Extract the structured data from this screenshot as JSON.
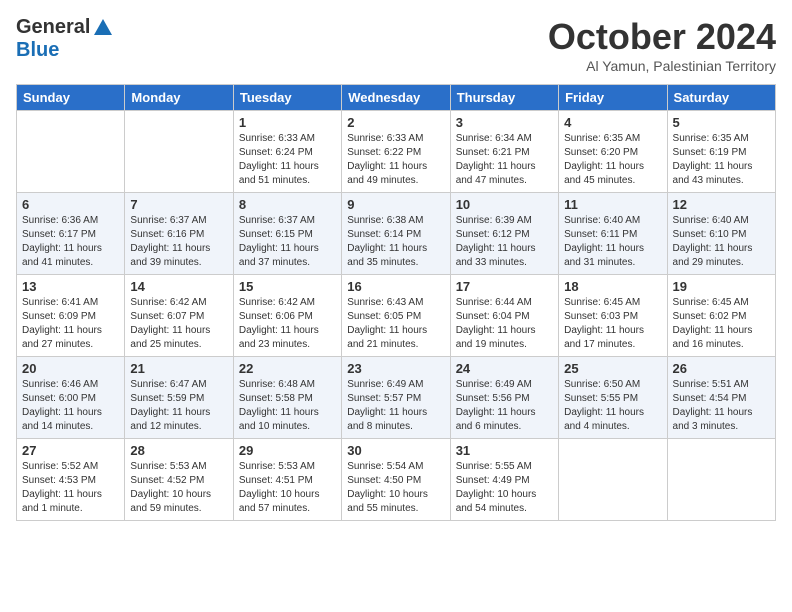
{
  "logo": {
    "general": "General",
    "blue": "Blue"
  },
  "title": "October 2024",
  "subtitle": "Al Yamun, Palestinian Territory",
  "days_of_week": [
    "Sunday",
    "Monday",
    "Tuesday",
    "Wednesday",
    "Thursday",
    "Friday",
    "Saturday"
  ],
  "weeks": [
    [
      {
        "day": "",
        "sunrise": "",
        "sunset": "",
        "daylight": ""
      },
      {
        "day": "",
        "sunrise": "",
        "sunset": "",
        "daylight": ""
      },
      {
        "day": "1",
        "sunrise": "Sunrise: 6:33 AM",
        "sunset": "Sunset: 6:24 PM",
        "daylight": "Daylight: 11 hours and 51 minutes."
      },
      {
        "day": "2",
        "sunrise": "Sunrise: 6:33 AM",
        "sunset": "Sunset: 6:22 PM",
        "daylight": "Daylight: 11 hours and 49 minutes."
      },
      {
        "day": "3",
        "sunrise": "Sunrise: 6:34 AM",
        "sunset": "Sunset: 6:21 PM",
        "daylight": "Daylight: 11 hours and 47 minutes."
      },
      {
        "day": "4",
        "sunrise": "Sunrise: 6:35 AM",
        "sunset": "Sunset: 6:20 PM",
        "daylight": "Daylight: 11 hours and 45 minutes."
      },
      {
        "day": "5",
        "sunrise": "Sunrise: 6:35 AM",
        "sunset": "Sunset: 6:19 PM",
        "daylight": "Daylight: 11 hours and 43 minutes."
      }
    ],
    [
      {
        "day": "6",
        "sunrise": "Sunrise: 6:36 AM",
        "sunset": "Sunset: 6:17 PM",
        "daylight": "Daylight: 11 hours and 41 minutes."
      },
      {
        "day": "7",
        "sunrise": "Sunrise: 6:37 AM",
        "sunset": "Sunset: 6:16 PM",
        "daylight": "Daylight: 11 hours and 39 minutes."
      },
      {
        "day": "8",
        "sunrise": "Sunrise: 6:37 AM",
        "sunset": "Sunset: 6:15 PM",
        "daylight": "Daylight: 11 hours and 37 minutes."
      },
      {
        "day": "9",
        "sunrise": "Sunrise: 6:38 AM",
        "sunset": "Sunset: 6:14 PM",
        "daylight": "Daylight: 11 hours and 35 minutes."
      },
      {
        "day": "10",
        "sunrise": "Sunrise: 6:39 AM",
        "sunset": "Sunset: 6:12 PM",
        "daylight": "Daylight: 11 hours and 33 minutes."
      },
      {
        "day": "11",
        "sunrise": "Sunrise: 6:40 AM",
        "sunset": "Sunset: 6:11 PM",
        "daylight": "Daylight: 11 hours and 31 minutes."
      },
      {
        "day": "12",
        "sunrise": "Sunrise: 6:40 AM",
        "sunset": "Sunset: 6:10 PM",
        "daylight": "Daylight: 11 hours and 29 minutes."
      }
    ],
    [
      {
        "day": "13",
        "sunrise": "Sunrise: 6:41 AM",
        "sunset": "Sunset: 6:09 PM",
        "daylight": "Daylight: 11 hours and 27 minutes."
      },
      {
        "day": "14",
        "sunrise": "Sunrise: 6:42 AM",
        "sunset": "Sunset: 6:07 PM",
        "daylight": "Daylight: 11 hours and 25 minutes."
      },
      {
        "day": "15",
        "sunrise": "Sunrise: 6:42 AM",
        "sunset": "Sunset: 6:06 PM",
        "daylight": "Daylight: 11 hours and 23 minutes."
      },
      {
        "day": "16",
        "sunrise": "Sunrise: 6:43 AM",
        "sunset": "Sunset: 6:05 PM",
        "daylight": "Daylight: 11 hours and 21 minutes."
      },
      {
        "day": "17",
        "sunrise": "Sunrise: 6:44 AM",
        "sunset": "Sunset: 6:04 PM",
        "daylight": "Daylight: 11 hours and 19 minutes."
      },
      {
        "day": "18",
        "sunrise": "Sunrise: 6:45 AM",
        "sunset": "Sunset: 6:03 PM",
        "daylight": "Daylight: 11 hours and 17 minutes."
      },
      {
        "day": "19",
        "sunrise": "Sunrise: 6:45 AM",
        "sunset": "Sunset: 6:02 PM",
        "daylight": "Daylight: 11 hours and 16 minutes."
      }
    ],
    [
      {
        "day": "20",
        "sunrise": "Sunrise: 6:46 AM",
        "sunset": "Sunset: 6:00 PM",
        "daylight": "Daylight: 11 hours and 14 minutes."
      },
      {
        "day": "21",
        "sunrise": "Sunrise: 6:47 AM",
        "sunset": "Sunset: 5:59 PM",
        "daylight": "Daylight: 11 hours and 12 minutes."
      },
      {
        "day": "22",
        "sunrise": "Sunrise: 6:48 AM",
        "sunset": "Sunset: 5:58 PM",
        "daylight": "Daylight: 11 hours and 10 minutes."
      },
      {
        "day": "23",
        "sunrise": "Sunrise: 6:49 AM",
        "sunset": "Sunset: 5:57 PM",
        "daylight": "Daylight: 11 hours and 8 minutes."
      },
      {
        "day": "24",
        "sunrise": "Sunrise: 6:49 AM",
        "sunset": "Sunset: 5:56 PM",
        "daylight": "Daylight: 11 hours and 6 minutes."
      },
      {
        "day": "25",
        "sunrise": "Sunrise: 6:50 AM",
        "sunset": "Sunset: 5:55 PM",
        "daylight": "Daylight: 11 hours and 4 minutes."
      },
      {
        "day": "26",
        "sunrise": "Sunrise: 5:51 AM",
        "sunset": "Sunset: 4:54 PM",
        "daylight": "Daylight: 11 hours and 3 minutes."
      }
    ],
    [
      {
        "day": "27",
        "sunrise": "Sunrise: 5:52 AM",
        "sunset": "Sunset: 4:53 PM",
        "daylight": "Daylight: 11 hours and 1 minute."
      },
      {
        "day": "28",
        "sunrise": "Sunrise: 5:53 AM",
        "sunset": "Sunset: 4:52 PM",
        "daylight": "Daylight: 10 hours and 59 minutes."
      },
      {
        "day": "29",
        "sunrise": "Sunrise: 5:53 AM",
        "sunset": "Sunset: 4:51 PM",
        "daylight": "Daylight: 10 hours and 57 minutes."
      },
      {
        "day": "30",
        "sunrise": "Sunrise: 5:54 AM",
        "sunset": "Sunset: 4:50 PM",
        "daylight": "Daylight: 10 hours and 55 minutes."
      },
      {
        "day": "31",
        "sunrise": "Sunrise: 5:55 AM",
        "sunset": "Sunset: 4:49 PM",
        "daylight": "Daylight: 10 hours and 54 minutes."
      },
      {
        "day": "",
        "sunrise": "",
        "sunset": "",
        "daylight": ""
      },
      {
        "day": "",
        "sunrise": "",
        "sunset": "",
        "daylight": ""
      }
    ]
  ]
}
